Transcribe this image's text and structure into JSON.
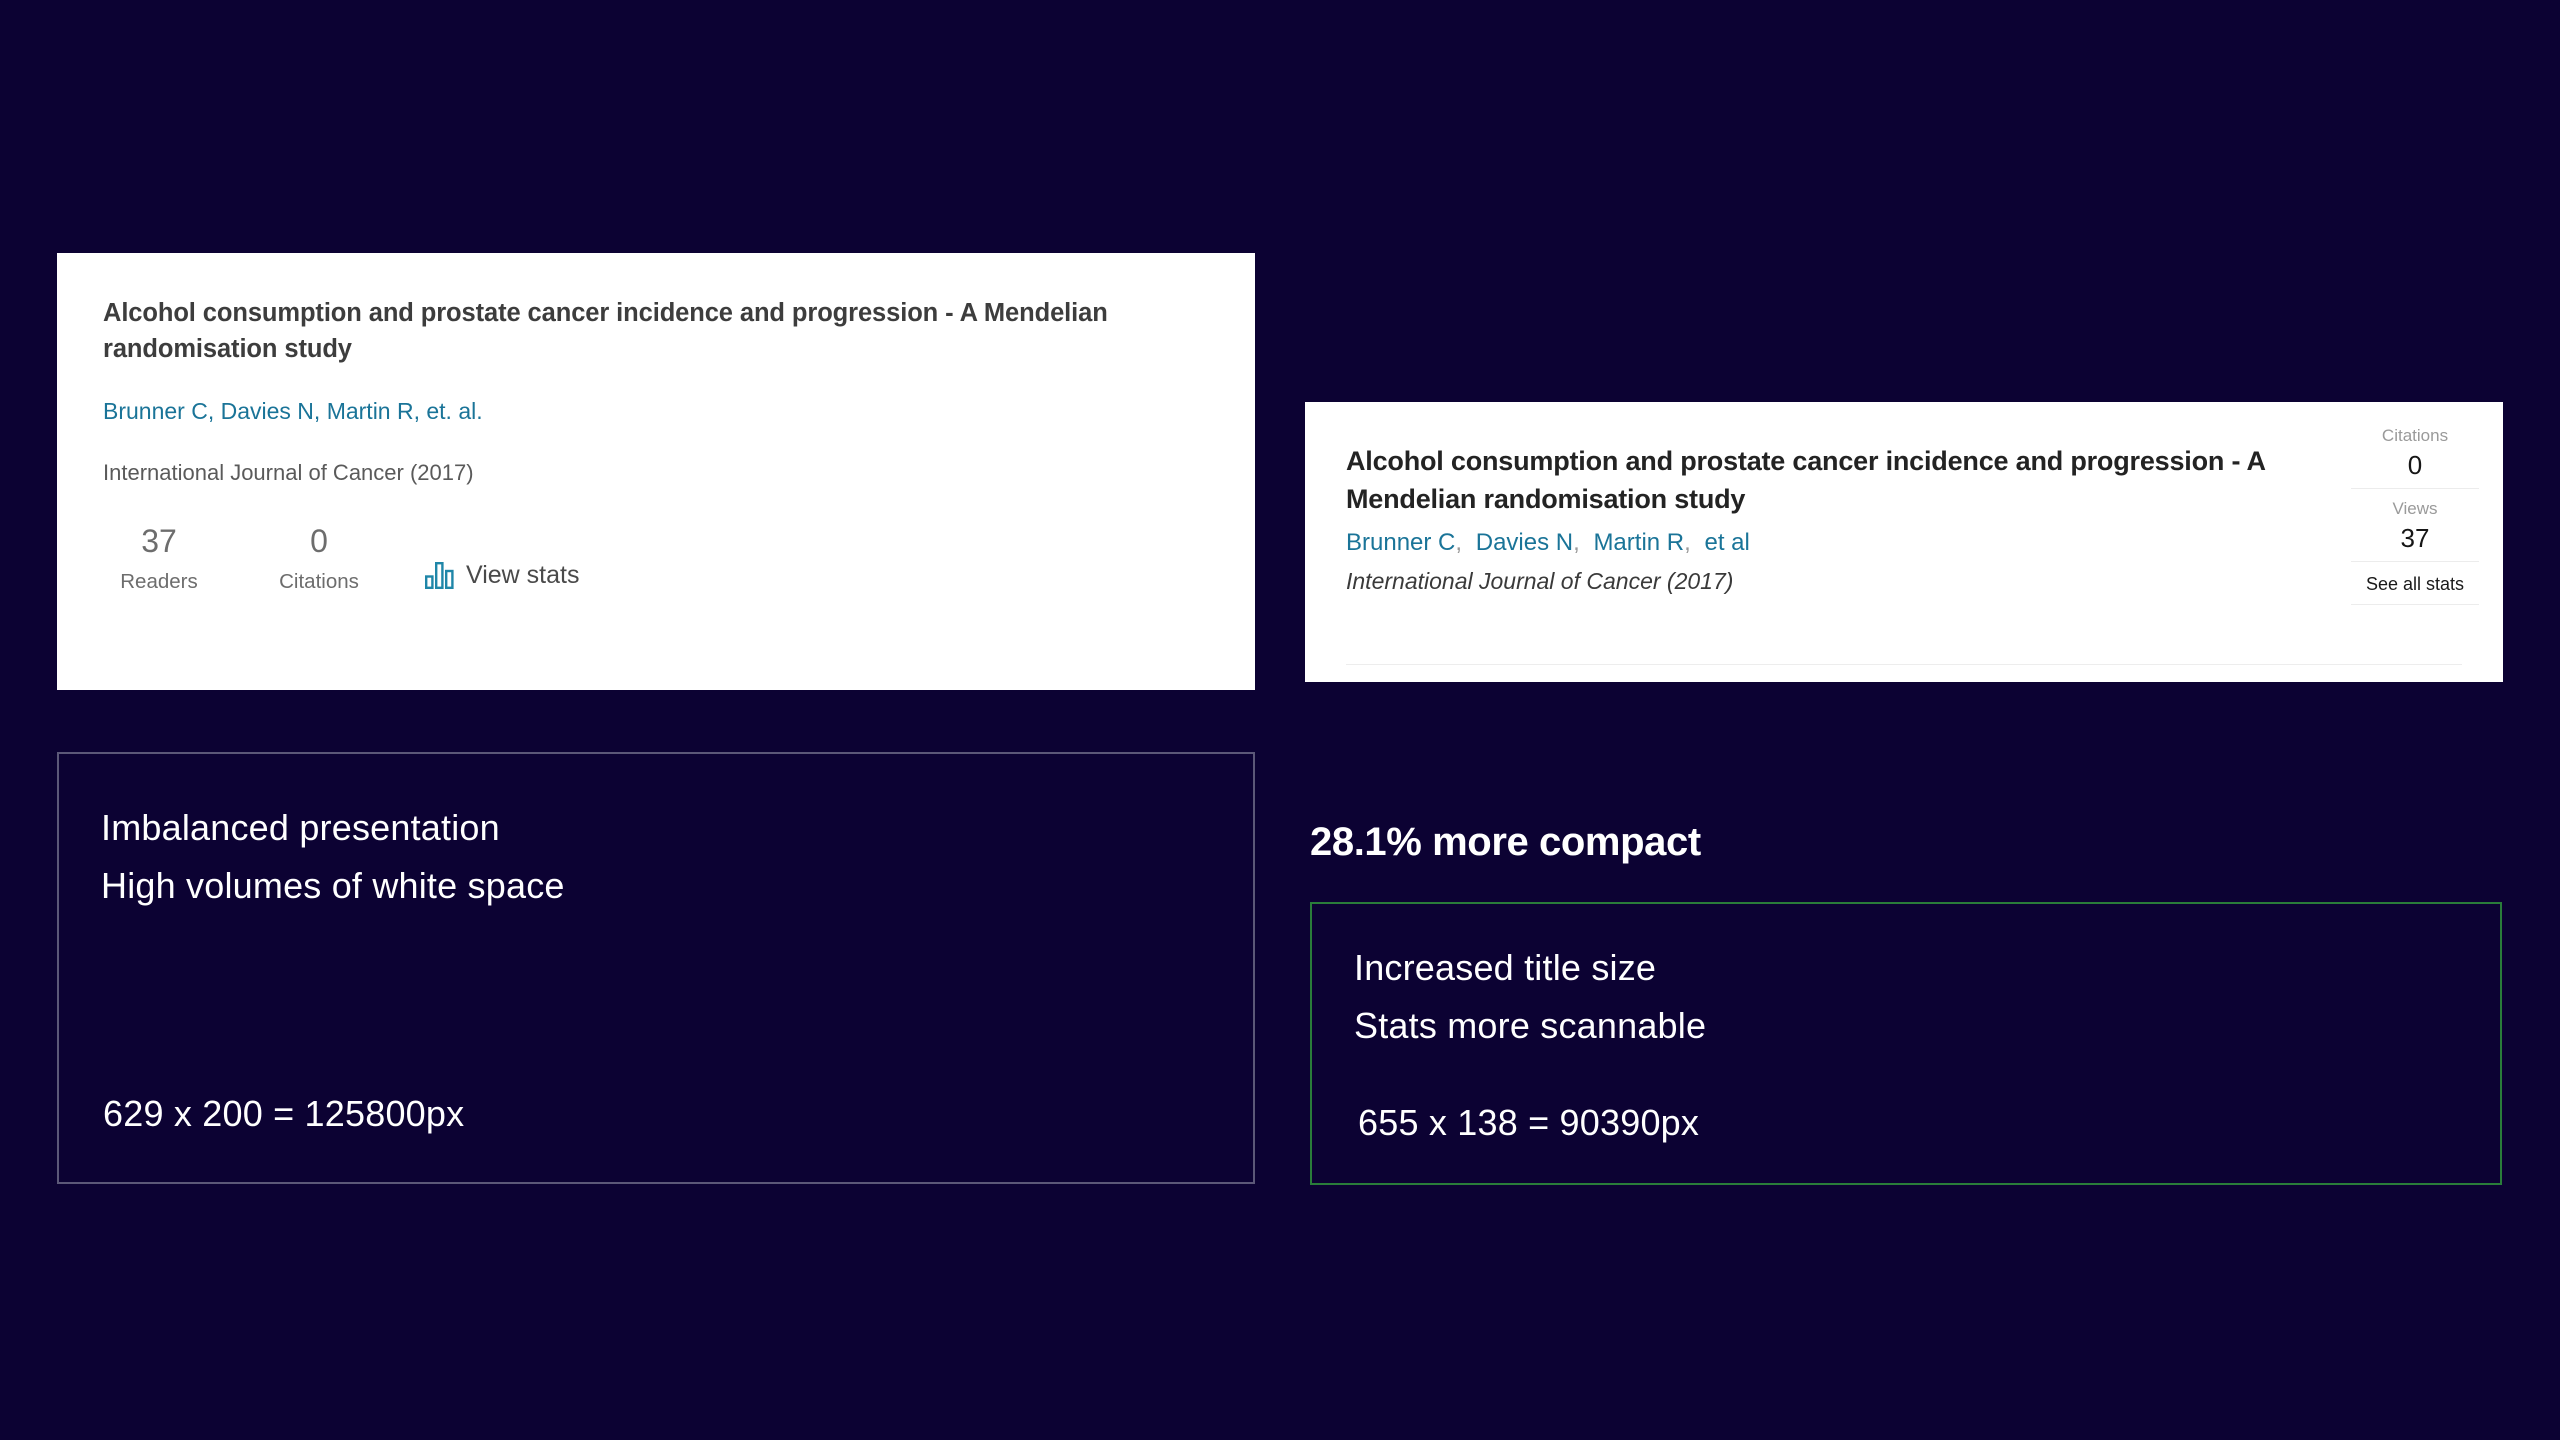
{
  "page": {
    "background_color": "#0c0233",
    "accent_link_color": "#1a7498",
    "green_border_color": "#2a7d3a",
    "gray_border_color": "#5c5878"
  },
  "old_card": {
    "title": "Alcohol consumption and prostate cancer incidence and progression - A Mendelian randomisation study",
    "authors": "Brunner C, Davies N, Martin R, et. al.",
    "journal": "International Journal of Cancer (2017)",
    "stats": [
      {
        "value": "37",
        "label": "Readers"
      },
      {
        "value": "0",
        "label": "Citations"
      }
    ],
    "view_stats_label": "View stats",
    "view_stats_icon": "bar-chart-icon"
  },
  "new_card": {
    "title": "Alcohol consumption and prostate cancer incidence and progression - A Mendelian randomisation study",
    "authors": [
      {
        "name": "Brunner C",
        "separator": ","
      },
      {
        "name": "Davies N",
        "separator": ","
      },
      {
        "name": "Martin R",
        "separator": ","
      },
      {
        "name": "et al",
        "separator": ""
      }
    ],
    "journal": "International Journal of Cancer (2017)",
    "stats": [
      {
        "label": "Citations",
        "value": "0"
      },
      {
        "label": "Views",
        "value": "37"
      }
    ],
    "see_all_stats_label": "See all stats"
  },
  "old_note": {
    "line1": "Imbalanced presentation",
    "line2": "High volumes of white space",
    "size": "629 x 200 = 125800px"
  },
  "new_note": {
    "heading": "28.1% more compact",
    "line1": "Increased title size",
    "line2": "Stats more scannable",
    "size": "655 x 138 = 90390px"
  }
}
